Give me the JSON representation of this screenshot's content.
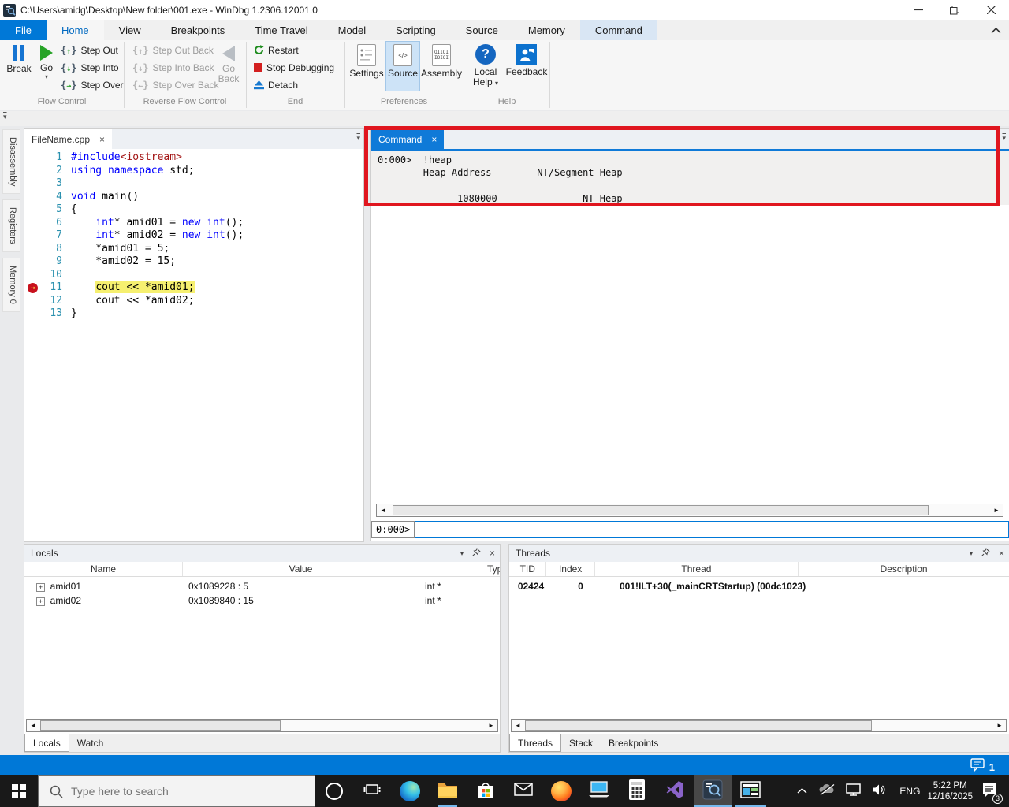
{
  "titlebar": {
    "title": "C:\\Users\\amidg\\Desktop\\New folder\\001.exe - WinDbg 1.2306.12001.0"
  },
  "ribbon": {
    "tabs": [
      "File",
      "Home",
      "View",
      "Breakpoints",
      "Time Travel",
      "Model",
      "Scripting",
      "Source",
      "Memory",
      "Command"
    ],
    "groups": {
      "flow_control": {
        "label": "Flow Control",
        "break": "Break",
        "go": "Go",
        "step_out": "Step Out",
        "step_into": "Step Into",
        "step_over": "Step Over"
      },
      "reverse_flow_control": {
        "label": "Reverse Flow Control",
        "step_out_back": "Step Out Back",
        "step_into_back": "Step Into Back",
        "step_over_back": "Step Over Back",
        "go_back_line1": "Go",
        "go_back_line2": "Back"
      },
      "end": {
        "label": "End",
        "restart": "Restart",
        "stop_debugging": "Stop Debugging",
        "detach": "Detach"
      },
      "preferences": {
        "label": "Preferences",
        "settings": "Settings",
        "source": "Source",
        "assembly": "Assembly"
      },
      "help": {
        "label": "Help",
        "local_help_line1": "Local",
        "local_help_line2": "Help",
        "feedback": "Feedback"
      }
    }
  },
  "side_tabs": {
    "disassembly": "Disassembly",
    "registers": "Registers",
    "memory": "Memory 0"
  },
  "source_pane": {
    "tab_label": "FileName.cpp",
    "lines": [
      {
        "num": "1",
        "segs": [
          {
            "t": "#include",
            "c": "kw"
          },
          {
            "t": "<iostream>",
            "c": "str"
          }
        ]
      },
      {
        "num": "2",
        "segs": [
          {
            "t": "using namespace",
            "c": "kw"
          },
          {
            "t": " std;",
            "c": "pl"
          }
        ]
      },
      {
        "num": "3",
        "segs": []
      },
      {
        "num": "4",
        "segs": [
          {
            "t": "void",
            "c": "kw"
          },
          {
            "t": " main()",
            "c": "pl"
          }
        ]
      },
      {
        "num": "5",
        "segs": [
          {
            "t": "{",
            "c": "pl"
          }
        ]
      },
      {
        "num": "6",
        "segs": [
          {
            "t": "    ",
            "c": "pl"
          },
          {
            "t": "int",
            "c": "kw"
          },
          {
            "t": "* amid01 = ",
            "c": "pl"
          },
          {
            "t": "new",
            "c": "kw"
          },
          {
            "t": " ",
            "c": "pl"
          },
          {
            "t": "int",
            "c": "kw"
          },
          {
            "t": "();",
            "c": "pl"
          }
        ]
      },
      {
        "num": "7",
        "segs": [
          {
            "t": "    ",
            "c": "pl"
          },
          {
            "t": "int",
            "c": "kw"
          },
          {
            "t": "* amid02 = ",
            "c": "pl"
          },
          {
            "t": "new",
            "c": "kw"
          },
          {
            "t": " ",
            "c": "pl"
          },
          {
            "t": "int",
            "c": "kw"
          },
          {
            "t": "();",
            "c": "pl"
          }
        ]
      },
      {
        "num": "8",
        "segs": [
          {
            "t": "    *amid01 = 5;",
            "c": "pl"
          }
        ]
      },
      {
        "num": "9",
        "segs": [
          {
            "t": "    *amid02 = 15;",
            "c": "pl"
          }
        ]
      },
      {
        "num": "10",
        "segs": []
      },
      {
        "num": "11",
        "marker": true,
        "segs": [
          {
            "t": "    ",
            "c": "pl"
          },
          {
            "t": "cout << *amid01;",
            "c": "hl"
          }
        ]
      },
      {
        "num": "12",
        "segs": [
          {
            "t": "    cout << *amid02;",
            "c": "pl"
          }
        ]
      },
      {
        "num": "13",
        "segs": [
          {
            "t": "}",
            "c": "pl"
          }
        ]
      }
    ]
  },
  "command_pane": {
    "tab_label": "Command",
    "output": "0:000>  !heap\n        Heap Address        NT/Segment Heap\n\n              1080000               NT Heap",
    "prompt": "0:000>"
  },
  "locals_pane": {
    "title": "Locals",
    "columns": {
      "name": "Name",
      "value": "Value",
      "type": "Typ"
    },
    "rows": [
      {
        "name": "amid01",
        "value": "0x1089228 : 5",
        "type": "int *"
      },
      {
        "name": "amid02",
        "value": "0x1089840 : 15",
        "type": "int *"
      }
    ],
    "tabs": {
      "locals": "Locals",
      "watch": "Watch"
    }
  },
  "threads_pane": {
    "title": "Threads",
    "columns": {
      "tid": "TID",
      "index": "Index",
      "thread": "Thread",
      "description": "Description"
    },
    "rows": [
      {
        "tid": "02424",
        "index": "0",
        "thread": "001!ILT+30(_mainCRTStartup) (00dc1023)",
        "description": ""
      }
    ],
    "tabs": {
      "threads": "Threads",
      "stack": "Stack",
      "breakpoints": "Breakpoints"
    }
  },
  "statusbar": {
    "notification_count": "1"
  },
  "taskbar": {
    "search_placeholder": "Type here to search",
    "tray": {
      "language": "ENG",
      "time": "5:22 PM",
      "date": "12/16/2025",
      "notification_badge": "3"
    }
  },
  "colors": {
    "accent": "#0078d7",
    "annotation_box": "#e0161f",
    "line_highlight": "#f6f070",
    "keyword": "#0000ff",
    "string_literal": "#a31515",
    "line_number": "#2b91af",
    "command_tab": "#0f7ad8",
    "taskbar_bg": "#191919"
  }
}
